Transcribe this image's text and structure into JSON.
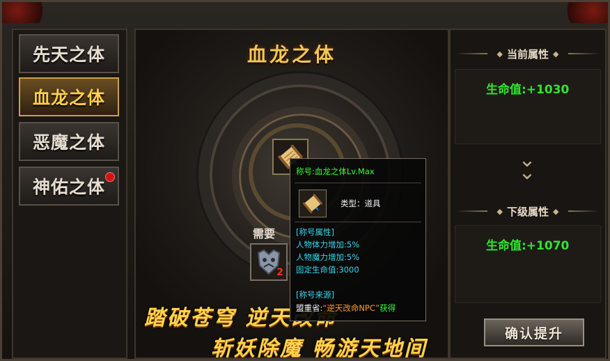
{
  "tabs": [
    {
      "label": "先天之体",
      "active": false,
      "red_dot": false
    },
    {
      "label": "血龙之体",
      "active": true,
      "red_dot": false
    },
    {
      "label": "恶魔之体",
      "active": false,
      "red_dot": false
    },
    {
      "label": "神佑之体",
      "active": false,
      "red_dot": true
    }
  ],
  "center": {
    "title": "血龙之体",
    "need_label": "需要",
    "need_item_count": "2",
    "slogan_1": "踏破苍穹  逆天改命",
    "slogan_2": "斩妖除魔  畅游天地间"
  },
  "right": {
    "current_header": "当前属性",
    "current_value": "生命值:+1030",
    "next_header": "下级属性",
    "next_value": "生命值:+1070",
    "confirm_button": "确认提升"
  },
  "tooltip": {
    "name": "称号:血龙之体Lv.Max",
    "type": "类型：道具",
    "attr_header": "[称号属性]",
    "attr_1": "人物体力增加:5%",
    "attr_2": "人物魔力增加:5%",
    "attr_3": "固定生命值:3000",
    "source_header": "[称号来源]",
    "source_prefix": "盟重省:",
    "source_npc": "“逆天改命NPC”",
    "source_suffix": "获得"
  },
  "colors": {
    "gold": "#f3c657",
    "green": "#2ee52e",
    "cyan": "#38d6f0",
    "red_dot": "#d01414"
  },
  "icons": [
    "scroll-icon",
    "demon-mask-icon",
    "double-chevron-down-icon"
  ]
}
